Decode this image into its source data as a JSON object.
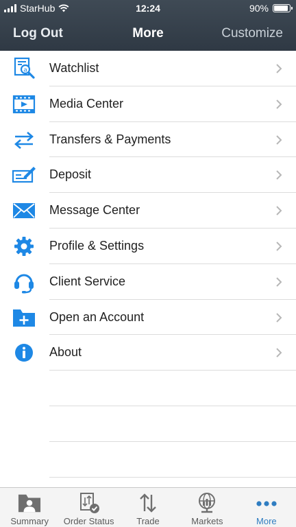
{
  "status_bar": {
    "carrier": "StarHub",
    "time": "12:24",
    "battery": "90%",
    "battery_level": 0.9
  },
  "nav": {
    "left": "Log Out",
    "title": "More",
    "right": "Customize"
  },
  "menu": [
    {
      "label": "Watchlist",
      "icon": "watchlist-icon"
    },
    {
      "label": "Media Center",
      "icon": "media-center-icon"
    },
    {
      "label": "Transfers & Payments",
      "icon": "transfer-arrows-icon"
    },
    {
      "label": "Deposit",
      "icon": "check-deposit-icon"
    },
    {
      "label": "Message Center",
      "icon": "envelope-icon"
    },
    {
      "label": "Profile & Settings",
      "icon": "gear-icon"
    },
    {
      "label": "Client Service",
      "icon": "headset-icon"
    },
    {
      "label": "Open an Account",
      "icon": "folder-plus-icon"
    },
    {
      "label": "About",
      "icon": "info-icon"
    }
  ],
  "tabs": [
    {
      "label": "Summary",
      "icon": "summary-person-icon"
    },
    {
      "label": "Order Status",
      "icon": "order-status-icon"
    },
    {
      "label": "Trade",
      "icon": "trade-arrows-icon"
    },
    {
      "label": "Markets",
      "icon": "globe-chart-icon"
    },
    {
      "label": "More",
      "icon": "ellipsis-icon"
    }
  ],
  "colors": {
    "accent": "#1e88e5",
    "navbar": "#353f4a",
    "active_tab": "#2f7dc1"
  }
}
